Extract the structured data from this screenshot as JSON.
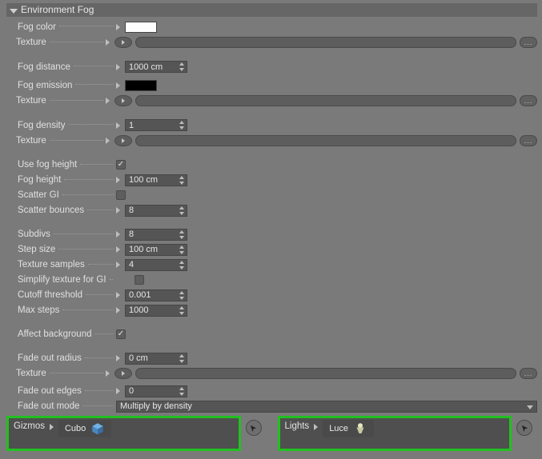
{
  "section_title": "Environment Fog",
  "rows": {
    "fog_color": "Fog color",
    "texture": "Texture",
    "fog_distance": "Fog distance",
    "fog_distance_val": "1000 cm",
    "fog_emission": "Fog emission",
    "fog_density": "Fog density",
    "fog_density_val": "1",
    "use_fog_height": "Use fog height",
    "fog_height": "Fog height",
    "fog_height_val": "100 cm",
    "scatter_gi": "Scatter GI",
    "scatter_bounces": "Scatter bounces",
    "scatter_bounces_val": "8",
    "subdivs": "Subdivs",
    "subdivs_val": "8",
    "step_size": "Step size",
    "step_size_val": "100 cm",
    "texture_samples": "Texture samples",
    "texture_samples_val": "4",
    "simplify_tex": "Simplify texture for GI",
    "cutoff": "Cutoff threshold",
    "cutoff_val": "0.001",
    "max_steps": "Max steps",
    "max_steps_val": "1000",
    "affect_bg": "Affect background",
    "fade_radius": "Fade out radius",
    "fade_radius_val": "0 cm",
    "fade_edges": "Fade out edges",
    "fade_edges_val": "0",
    "fade_mode": "Fade out mode",
    "fade_mode_val": "Multiply by density",
    "gizmos": "Gizmos",
    "gizmo_chip": "Cubo",
    "lights": "Lights",
    "lights_chip": "Luce"
  },
  "tex_end": "...",
  "colors": {
    "highlight": "#21c121"
  }
}
